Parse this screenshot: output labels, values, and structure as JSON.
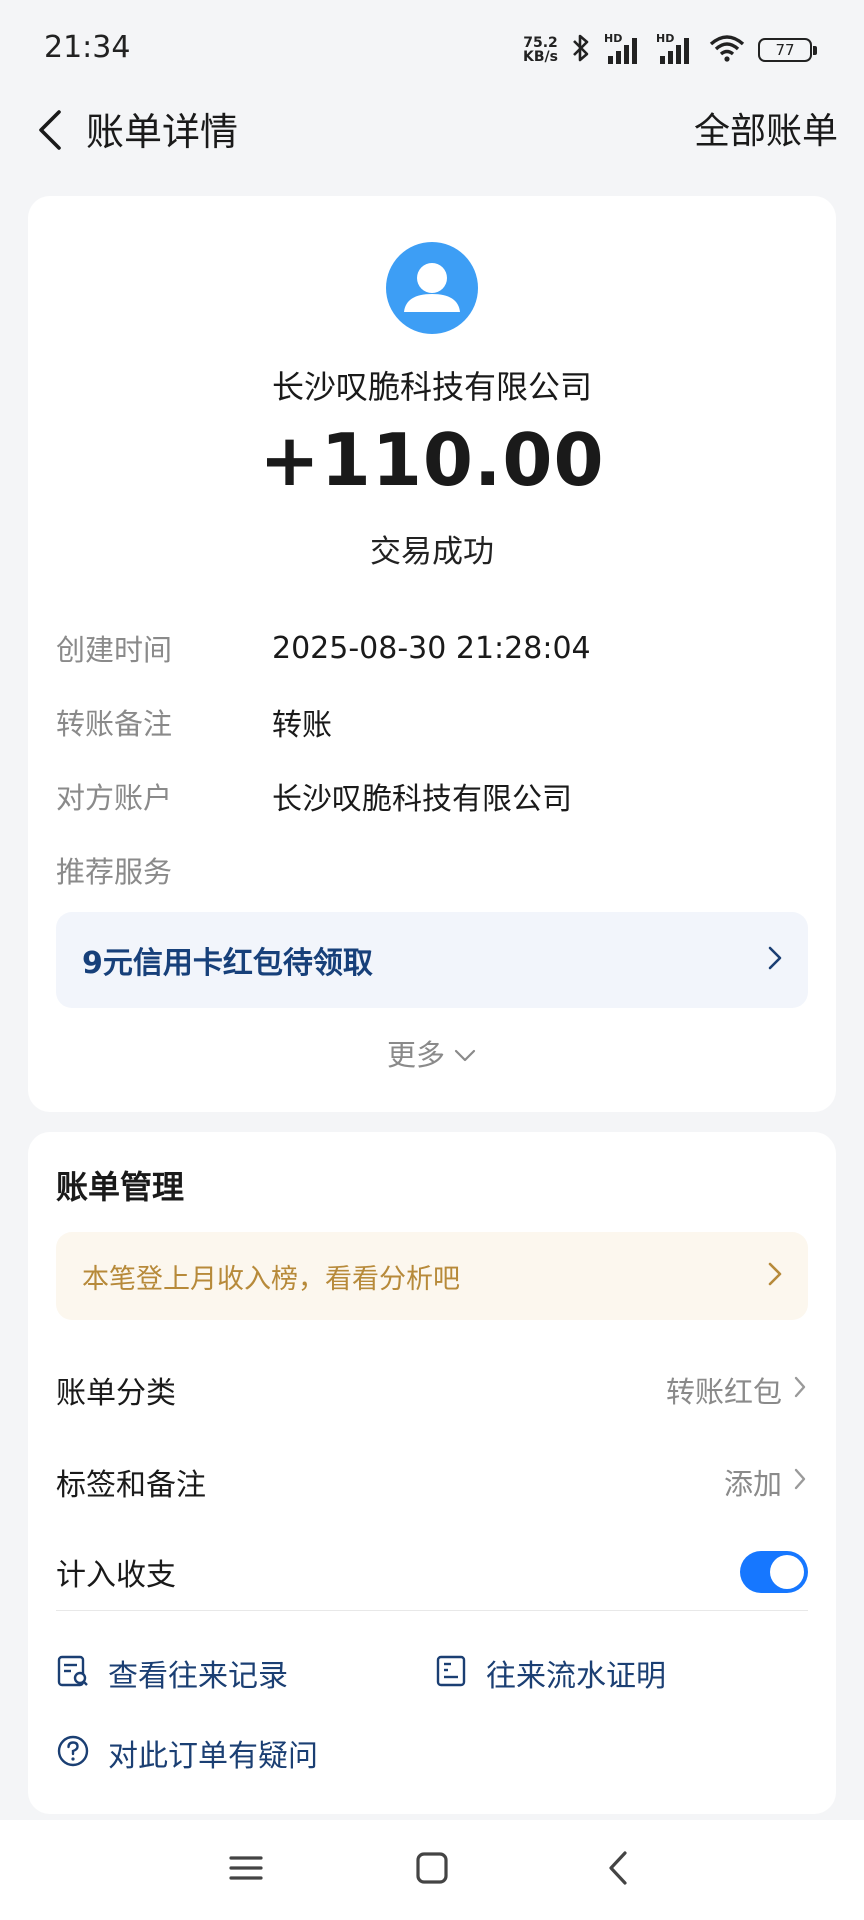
{
  "status_bar": {
    "time": "21:34",
    "net_speed_value": "75.2",
    "net_speed_unit": "KB/s",
    "signal1_label": "HD",
    "signal2_label": "HD",
    "battery": "77"
  },
  "nav": {
    "title": "账单详情",
    "right_action": "全部账单"
  },
  "transaction": {
    "merchant": "长沙叹脆科技有限公司",
    "amount": "+110.00",
    "status": "交易成功"
  },
  "details": [
    {
      "label": "创建时间",
      "value": "2025-08-30 21:28:04"
    },
    {
      "label": "转账备注",
      "value": "转账"
    },
    {
      "label": "对方账户",
      "value": "长沙叹脆科技有限公司"
    },
    {
      "label": "推荐服务",
      "value": ""
    }
  ],
  "promo": {
    "text": "9元信用卡红包待领取"
  },
  "more": {
    "label": "更多"
  },
  "manage": {
    "title": "账单管理",
    "analysis_tip": "本笔登上月收入榜，看看分析吧",
    "category_label": "账单分类",
    "category_value": "转账红包",
    "tags_label": "标签和备注",
    "tags_value": "添加",
    "count_label": "计入收支",
    "count_enabled": true,
    "links": {
      "history": "查看往来记录",
      "statement": "往来流水证明",
      "question": "对此订单有疑问"
    }
  },
  "colors": {
    "accent": "#1677ff",
    "avatar": "#3d9ef5",
    "link": "#1b3f73",
    "tip": "#b78a3a"
  },
  "icons": {
    "back": "chevron-left-icon",
    "avatar": "user-icon",
    "promo_arrow": "chevron-right-icon",
    "more_arrow": "chevron-down-icon",
    "history": "record-search-icon",
    "statement": "document-icon",
    "question": "question-circle-icon"
  }
}
